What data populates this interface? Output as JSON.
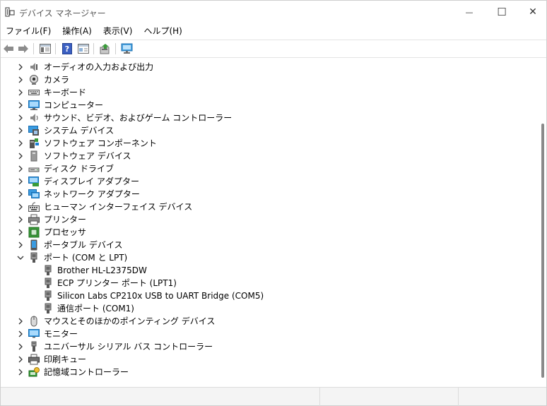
{
  "window": {
    "title": "デバイス マネージャー",
    "icon": "device-manager-icon"
  },
  "caption_buttons": {
    "minimize": "—",
    "maximize": "☐",
    "close": "✕"
  },
  "menu": {
    "items": [
      "ファイル(F)",
      "操作(A)",
      "表示(V)",
      "ヘルプ(H)"
    ]
  },
  "toolbar": {
    "buttons": [
      "back-icon",
      "forward-icon",
      "properties-view-icon",
      "help-icon",
      "resources-view-icon",
      "update-driver-icon",
      "scan-hardware-icon"
    ]
  },
  "tree": {
    "items": [
      {
        "label": "オーディオの入力および出力",
        "icon": "audio-io-icon",
        "expanded": false,
        "level": 0
      },
      {
        "label": "カメラ",
        "icon": "camera-icon",
        "expanded": false,
        "level": 0
      },
      {
        "label": "キーボード",
        "icon": "keyboard-icon",
        "expanded": false,
        "level": 0
      },
      {
        "label": "コンピューター",
        "icon": "computer-icon",
        "expanded": false,
        "level": 0
      },
      {
        "label": "サウンド、ビデオ、およびゲーム コントローラー",
        "icon": "speaker-icon",
        "expanded": false,
        "level": 0
      },
      {
        "label": "システム デバイス",
        "icon": "system-devices-icon",
        "expanded": false,
        "level": 0
      },
      {
        "label": "ソフトウェア コンポーネント",
        "icon": "software-component-icon",
        "expanded": false,
        "level": 0
      },
      {
        "label": "ソフトウェア デバイス",
        "icon": "software-device-icon",
        "expanded": false,
        "level": 0
      },
      {
        "label": "ディスク ドライブ",
        "icon": "disk-drive-icon",
        "expanded": false,
        "level": 0
      },
      {
        "label": "ディスプレイ アダプター",
        "icon": "display-adapter-icon",
        "expanded": false,
        "level": 0
      },
      {
        "label": "ネットワーク アダプター",
        "icon": "network-adapter-icon",
        "expanded": false,
        "level": 0
      },
      {
        "label": "ヒューマン インターフェイス デバイス",
        "icon": "hid-icon",
        "expanded": false,
        "level": 0
      },
      {
        "label": "プリンター",
        "icon": "printer-icon",
        "expanded": false,
        "level": 0
      },
      {
        "label": "プロセッサ",
        "icon": "processor-icon",
        "expanded": false,
        "level": 0
      },
      {
        "label": "ポータブル デバイス",
        "icon": "portable-device-icon",
        "expanded": false,
        "level": 0
      },
      {
        "label": "ポート (COM と LPT)",
        "icon": "port-icon",
        "expanded": true,
        "level": 0
      },
      {
        "label": "Brother HL-L2375DW",
        "icon": "port-icon",
        "level": 1
      },
      {
        "label": "ECP プリンター ポート (LPT1)",
        "icon": "port-icon",
        "level": 1
      },
      {
        "label": "Silicon Labs CP210x USB to UART Bridge (COM5)",
        "icon": "port-icon",
        "level": 1
      },
      {
        "label": "通信ポート (COM1)",
        "icon": "port-icon",
        "level": 1
      },
      {
        "label": "マウスとそのほかのポインティング デバイス",
        "icon": "mouse-icon",
        "expanded": false,
        "level": 0
      },
      {
        "label": "モニター",
        "icon": "monitor-icon",
        "expanded": false,
        "level": 0
      },
      {
        "label": "ユニバーサル シリアル バス コントローラー",
        "icon": "usb-icon",
        "expanded": false,
        "level": 0
      },
      {
        "label": "印刷キュー",
        "icon": "print-queue-icon",
        "expanded": false,
        "level": 0
      },
      {
        "label": "記憶域コントローラー",
        "icon": "storage-controller-icon",
        "expanded": false,
        "level": 0
      }
    ]
  },
  "colors": {
    "accent_blue": "#1e7fd6",
    "icon_gray": "#6e6e6e",
    "green": "#3a9b3a"
  }
}
